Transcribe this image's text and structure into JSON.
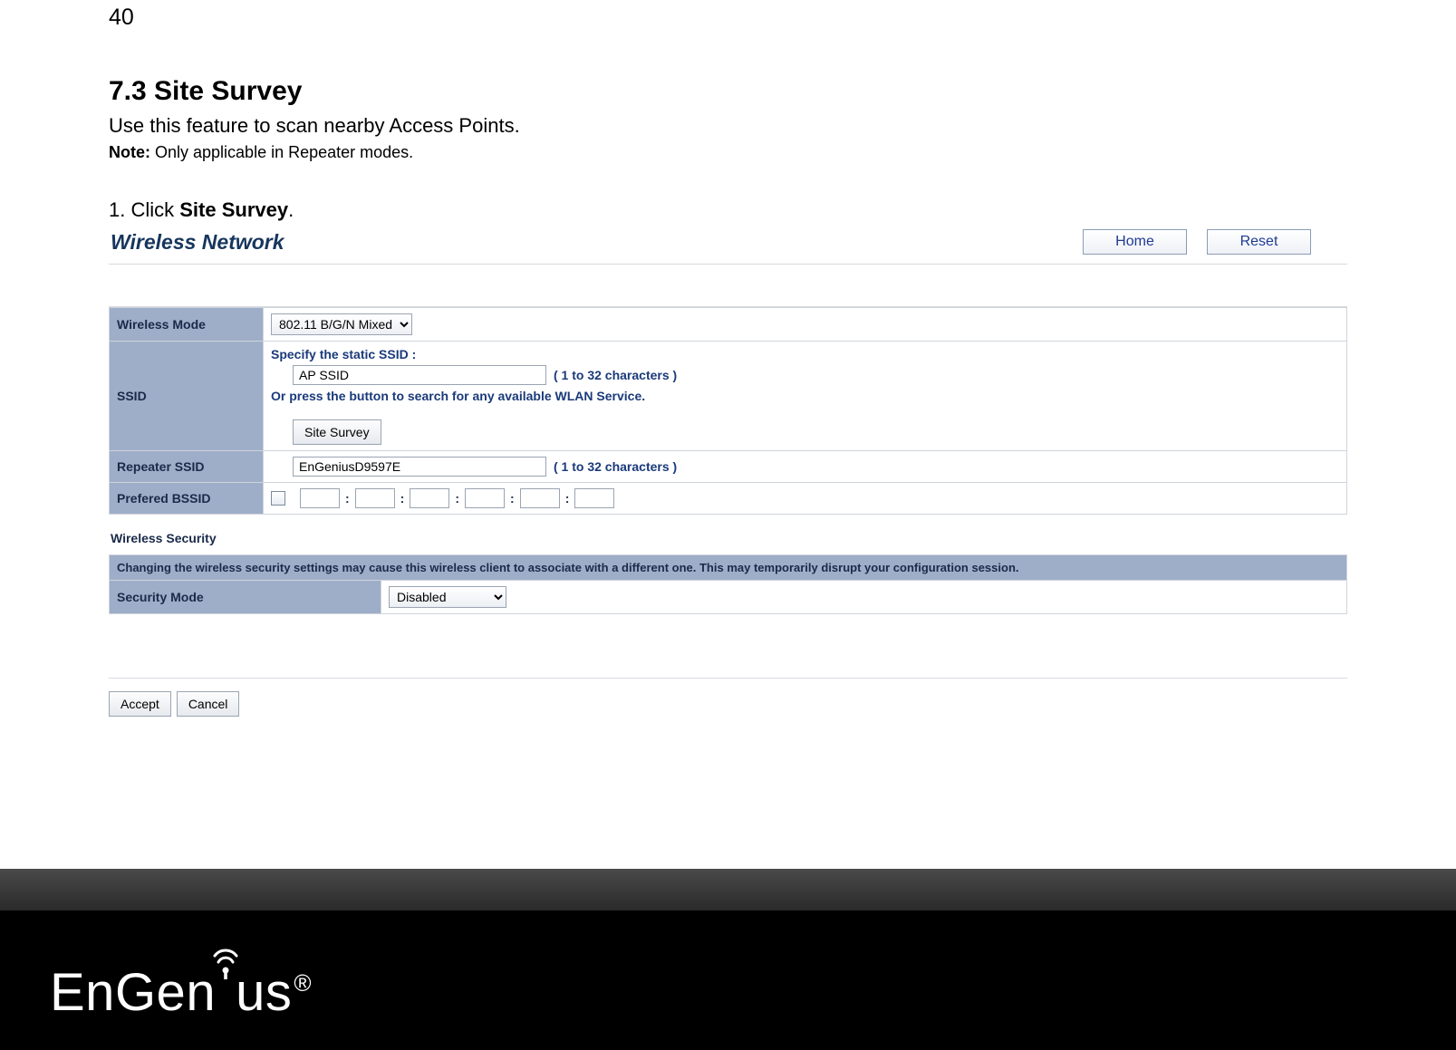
{
  "page_number": "40",
  "heading": "7.3   Site Survey",
  "intro": "Use this feature to scan nearby Access Points.",
  "note_label": "Note:",
  "note_text": " Only applicable in Repeater modes.",
  "step_prefix": "1. Click ",
  "step_bold": "Site Survey",
  "step_suffix": ".",
  "panel": {
    "title": "Wireless Network",
    "home_btn": "Home",
    "reset_btn": "Reset"
  },
  "form": {
    "wireless_mode_label": "Wireless Mode",
    "wireless_mode_value": "802.11 B/G/N Mixed",
    "ssid_label": "SSID",
    "ssid_static_text": "Specify the static SSID  :",
    "ssid_value": "AP SSID",
    "ssid_chars": "( 1 to 32 characters )",
    "ssid_search_text": "Or press the button to search for any available WLAN Service.",
    "site_survey_btn": "Site Survey",
    "repeater_label": "Repeater SSID",
    "repeater_value": "EnGeniusD9597E",
    "repeater_chars": "( 1 to 32 characters )",
    "bssid_label": "Prefered BSSID"
  },
  "security": {
    "title": "Wireless Security",
    "warning": "Changing the wireless security settings may cause this wireless client to associate with a different one. This may temporarily disrupt your configuration session.",
    "mode_label": "Security Mode",
    "mode_value": "Disabled"
  },
  "actions": {
    "accept": "Accept",
    "cancel": "Cancel"
  },
  "footer": {
    "logo_text": "EnGenius",
    "reg": "®"
  }
}
